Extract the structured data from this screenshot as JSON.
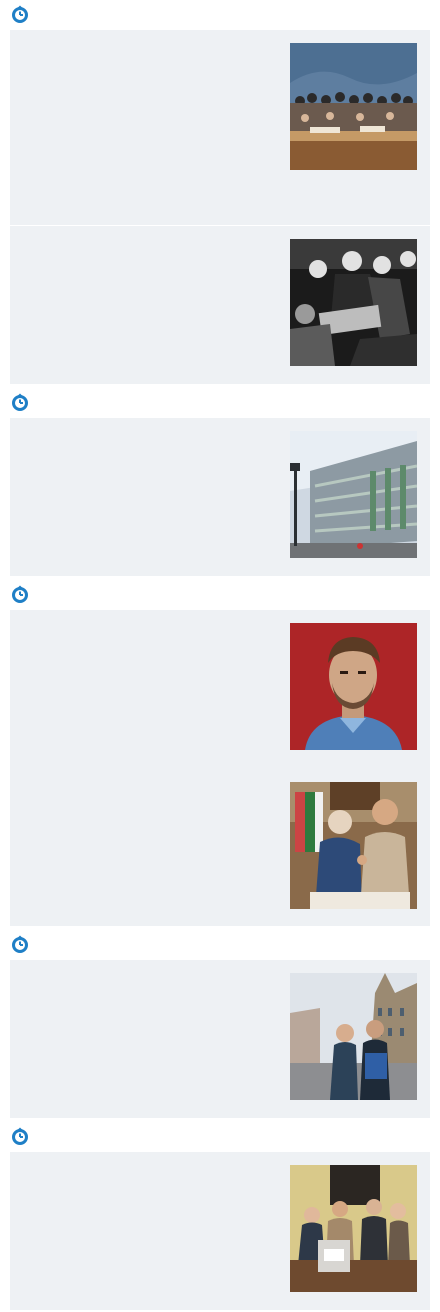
{
  "feed": {
    "sections": [
      {
        "header_icon": "clock-icon",
        "items": [
          {
            "image": "thumbnail-meeting-table",
            "text": ""
          },
          {
            "image": "thumbnail-bw-signing",
            "text": ""
          }
        ]
      },
      {
        "header_icon": "clock-icon",
        "items": [
          {
            "image": "thumbnail-modern-building",
            "text": ""
          }
        ]
      },
      {
        "header_icon": "clock-icon",
        "items": [
          {
            "image": "thumbnail-portrait-man",
            "text": ""
          },
          {
            "image": "thumbnail-handshake",
            "text": ""
          }
        ]
      },
      {
        "header_icon": "clock-icon",
        "items": [
          {
            "image": "thumbnail-square-couple",
            "text": ""
          }
        ]
      },
      {
        "header_icon": "clock-icon",
        "items": [
          {
            "image": "thumbnail-ballot-box-group",
            "text": ""
          }
        ]
      }
    ]
  },
  "colors": {
    "accent": "#1f7fc6",
    "card_background": "#eef1f4",
    "page_background": "#ffffff"
  }
}
